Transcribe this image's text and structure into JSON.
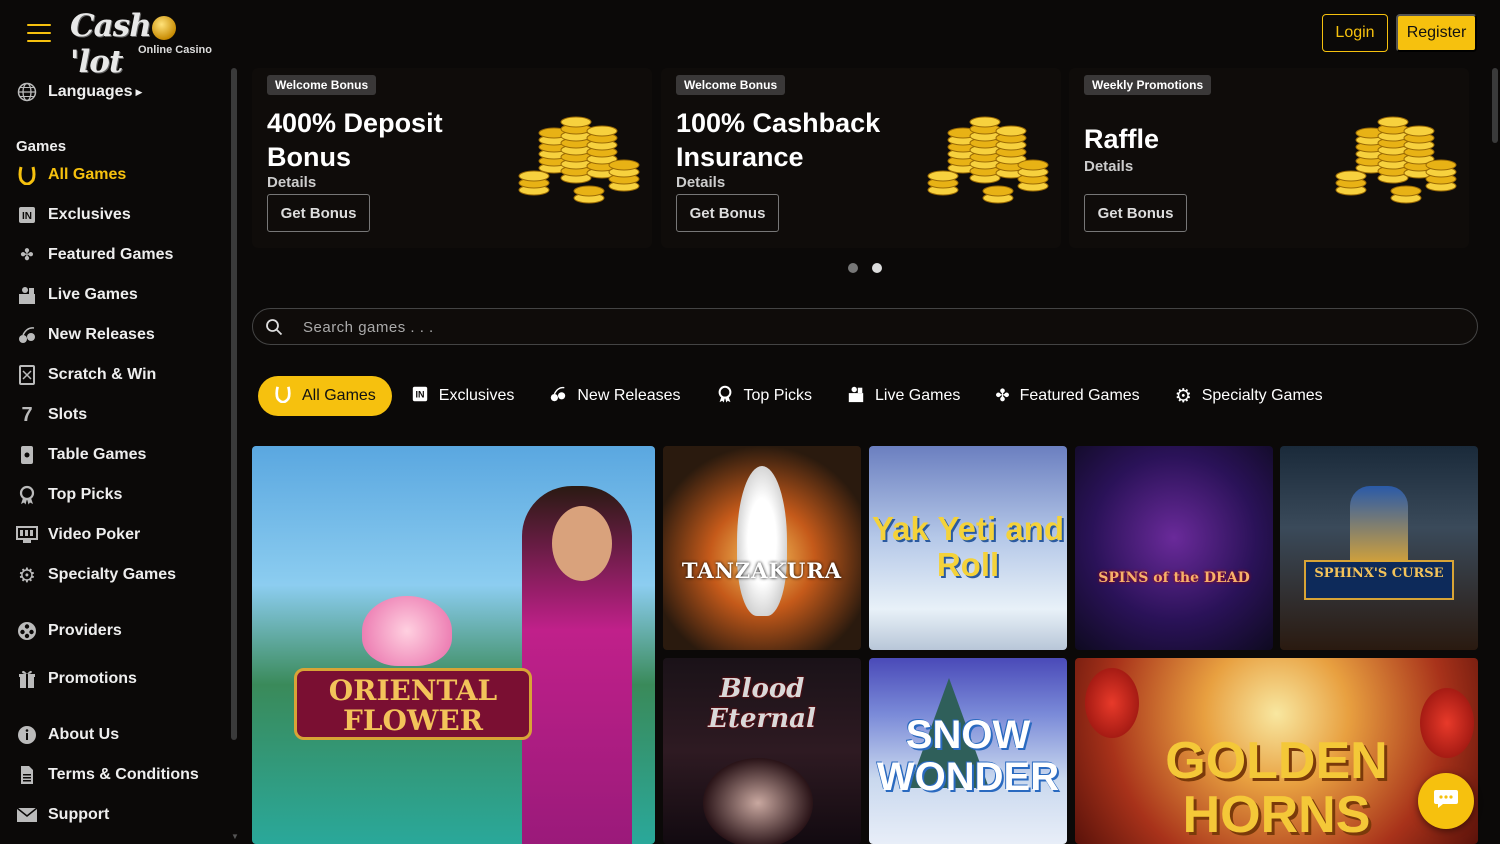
{
  "header": {
    "logo_text": "Cash lot",
    "logo_sub": "Online Casino",
    "login_label": "Login",
    "register_label": "Register"
  },
  "sidebar": {
    "languages_label": "Languages",
    "games_heading": "Games",
    "items": [
      {
        "label": "All Games",
        "icon": "horseshoe-icon",
        "active": true
      },
      {
        "label": "Exclusives",
        "icon": "exclusive-badge-icon"
      },
      {
        "label": "Featured Games",
        "icon": "clover-icon"
      },
      {
        "label": "Live Games",
        "icon": "live-dealer-icon"
      },
      {
        "label": "New Releases",
        "icon": "cherries-icon"
      },
      {
        "label": "Scratch & Win",
        "icon": "scratch-card-icon"
      },
      {
        "label": "Slots",
        "icon": "seven-icon"
      },
      {
        "label": "Table Games",
        "icon": "card-icon"
      },
      {
        "label": "Top Picks",
        "icon": "award-icon"
      },
      {
        "label": "Video Poker",
        "icon": "monitor-icon"
      },
      {
        "label": "Specialty Games",
        "icon": "gear-icon"
      }
    ],
    "providers_label": "Providers",
    "promotions_label": "Promotions",
    "about_label": "About Us",
    "terms_label": "Terms & Conditions",
    "support_label": "Support"
  },
  "promos": [
    {
      "badge": "Welcome Bonus",
      "title": "400% Deposit Bonus",
      "details": "Details",
      "button": "Get Bonus"
    },
    {
      "badge": "Welcome Bonus",
      "title": "100% Cashback Insurance",
      "details": "Details",
      "button": "Get Bonus"
    },
    {
      "badge": "Weekly Promotions",
      "title": "Raffle",
      "details": "Details",
      "button": "Get Bonus"
    }
  ],
  "carousel": {
    "active_index": 1,
    "count": 2
  },
  "search": {
    "placeholder": "Search games . . ."
  },
  "tabs": [
    {
      "label": "All Games",
      "icon": "horseshoe-icon",
      "active": true
    },
    {
      "label": "Exclusives",
      "icon": "exclusive-badge-icon"
    },
    {
      "label": "New Releases",
      "icon": "cherries-icon"
    },
    {
      "label": "Top Picks",
      "icon": "award-icon"
    },
    {
      "label": "Live Games",
      "icon": "live-dealer-icon"
    },
    {
      "label": "Featured Games",
      "icon": "clover-icon"
    },
    {
      "label": "Specialty Games",
      "icon": "gear-icon"
    }
  ],
  "games": [
    {
      "name": "ORIENTAL FLOWER"
    },
    {
      "name": "TANZAKURA"
    },
    {
      "name": "Yak Yeti and Roll"
    },
    {
      "name": "SPINS of the DEAD"
    },
    {
      "name": "SPHINX'S CURSE"
    },
    {
      "name": "Blood Eternal"
    },
    {
      "name": "SNOW WONDER"
    },
    {
      "name": "GOLDEN HORNS"
    }
  ],
  "colors": {
    "accent": "#f6c10e",
    "background": "#0b0908"
  }
}
